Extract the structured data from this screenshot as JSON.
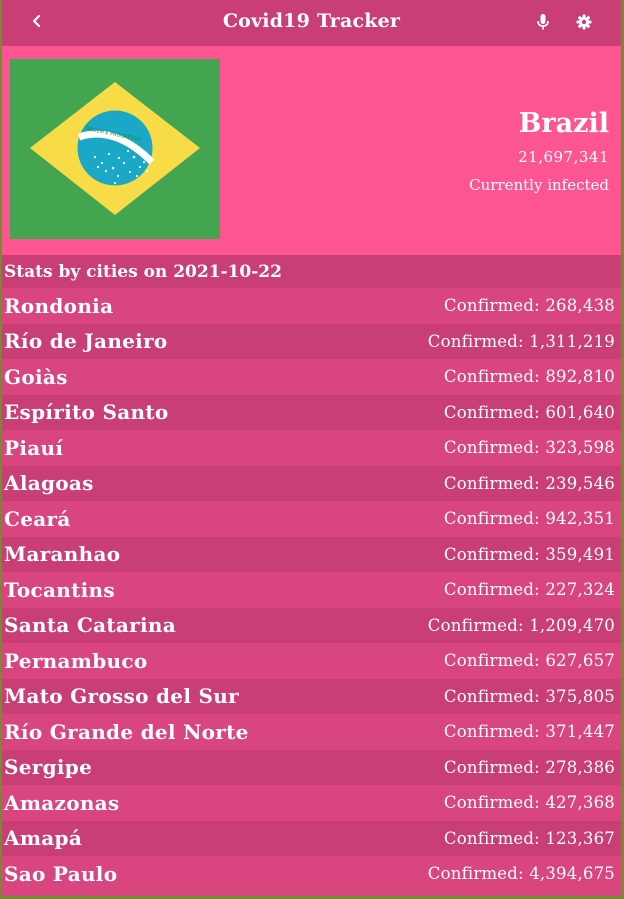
{
  "header": {
    "title": "Covid19 Tracker",
    "back_icon": "chevron-left-icon",
    "mic_icon": "microphone-icon",
    "settings_icon": "gear-icon"
  },
  "country": {
    "name": "Brazil",
    "infected": "21,697,341",
    "subtitle": "Currently infected",
    "flag_motto": "ORDEM E PROGRESSO"
  },
  "stats": {
    "title": "Stats by cities on 2021-10-22",
    "rows": [
      {
        "city": "Rondonia",
        "confirmed": "Confirmed: 268,438"
      },
      {
        "city": "Río de Janeiro",
        "confirmed": "Confirmed: 1,311,219"
      },
      {
        "city": "Goiàs",
        "confirmed": "Confirmed: 892,810"
      },
      {
        "city": "Espírito Santo",
        "confirmed": "Confirmed: 601,640"
      },
      {
        "city": "Piauí",
        "confirmed": "Confirmed: 323,598"
      },
      {
        "city": "Alagoas",
        "confirmed": "Confirmed: 239,546"
      },
      {
        "city": "Ceará",
        "confirmed": "Confirmed: 942,351"
      },
      {
        "city": "Maranhao",
        "confirmed": "Confirmed: 359,491"
      },
      {
        "city": "Tocantins",
        "confirmed": "Confirmed: 227,324"
      },
      {
        "city": "Santa Catarina",
        "confirmed": "Confirmed: 1,209,470"
      },
      {
        "city": "Pernambuco",
        "confirmed": "Confirmed: 627,657"
      },
      {
        "city": "Mato Grosso del Sur",
        "confirmed": "Confirmed: 375,805"
      },
      {
        "city": "Río Grande del Norte",
        "confirmed": "Confirmed: 371,447"
      },
      {
        "city": "Sergipe",
        "confirmed": "Confirmed: 278,386"
      },
      {
        "city": "Amazonas",
        "confirmed": "Confirmed: 427,368"
      },
      {
        "city": "Amapá",
        "confirmed": "Confirmed: 123,367"
      },
      {
        "city": "Sao Paulo",
        "confirmed": "Confirmed: 4,394,675"
      }
    ]
  },
  "colors": {
    "header_bg": "#c93e74",
    "hero_bg": "#fd5592",
    "row_light": "#d8457f",
    "row_dark": "#c93e74",
    "flag_green": "#43a550",
    "flag_yellow": "#f7dc47",
    "flag_blue": "#1ba7c6"
  }
}
